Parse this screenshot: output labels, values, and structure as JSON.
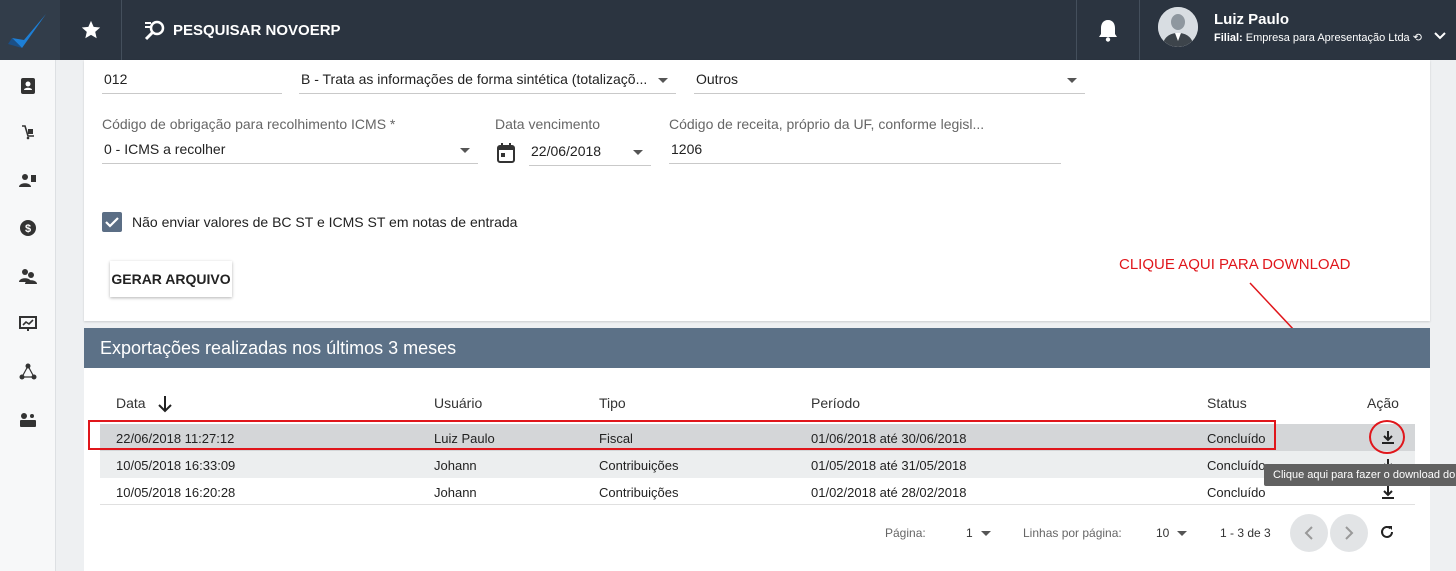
{
  "topbar": {
    "search_label": "PESQUISAR NOVOERP",
    "user_name": "Luiz Paulo",
    "branch_label": "Filial:",
    "branch_name": "Empresa para Apresentação Ltda"
  },
  "sidebar": {
    "items": [
      "contacts-icon",
      "product-icon",
      "users-icon",
      "finance-icon",
      "people-icon",
      "dashboard-icon",
      "network-icon",
      "settings-icon"
    ]
  },
  "form": {
    "field1_value": "012",
    "field2_value": "B - Trata as informações de forma sintética (totalizaçõ...",
    "field3_value": "Outros",
    "obligation_label": "Código de obrigação para recolhimento ICMS *",
    "obligation_value": "0 - ICMS a recolher",
    "due_date_label": "Data vencimento",
    "due_date_value": "22/06/2018",
    "revenue_label": "Código de receita, próprio da UF, conforme legisl...",
    "revenue_value": "1206",
    "checkbox_label": "Não enviar valores de BC ST e ICMS ST em notas de entrada",
    "checkbox_checked": true,
    "generate_button": "GERAR ARQUIVO"
  },
  "annotation": {
    "text": "CLIQUE AQUI PARA DOWNLOAD",
    "color": "#e0161b"
  },
  "exports": {
    "title": "Exportações realizadas nos últimos 3 meses",
    "columns": {
      "date": "Data",
      "user": "Usuário",
      "type": "Tipo",
      "period": "Período",
      "status": "Status",
      "action": "Ação"
    },
    "rows": [
      {
        "date": "22/06/2018 11:27:12",
        "user": "Luiz Paulo",
        "type": "Fiscal",
        "period": "01/06/2018 até 30/06/2018",
        "status": "Concluído"
      },
      {
        "date": "10/05/2018 16:33:09",
        "user": "Johann",
        "type": "Contribuições",
        "period": "01/05/2018 até 31/05/2018",
        "status": "Concluído"
      },
      {
        "date": "10/05/2018 16:20:28",
        "user": "Johann",
        "type": "Contribuições",
        "period": "01/02/2018 até 28/02/2018",
        "status": "Concluído"
      }
    ],
    "tooltip": "Clique aqui para fazer o download do zip",
    "pagination": {
      "page_label": "Página:",
      "page_value": "1",
      "rows_label": "Linhas por página:",
      "rows_value": "10",
      "range": "1 - 3 de 3"
    }
  },
  "colors": {
    "topbar": "#2b3440",
    "header": "#5c7187",
    "accent_red": "#e0161b"
  }
}
